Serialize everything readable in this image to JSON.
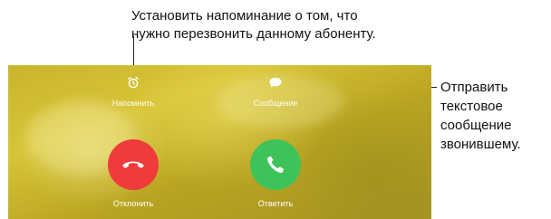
{
  "callouts": {
    "remind_line1": "Установить напоминание о том, что",
    "remind_line2": "нужно перезвонить данному абоненту.",
    "message_line1": "Отправить",
    "message_line2": "текстовое",
    "message_line3": "сообщение",
    "message_line4": "звонившему."
  },
  "call_screen": {
    "remind": {
      "label": "Напомнить",
      "icon": "alarm-clock-icon"
    },
    "message": {
      "label": "Сообщение",
      "icon": "speech-bubble-icon"
    },
    "decline": {
      "label": "Отклонить",
      "icon": "phone-hangup-icon",
      "color": "#ef3b3b"
    },
    "accept": {
      "label": "Ответить",
      "icon": "phone-icon",
      "color": "#3ec35a"
    }
  }
}
